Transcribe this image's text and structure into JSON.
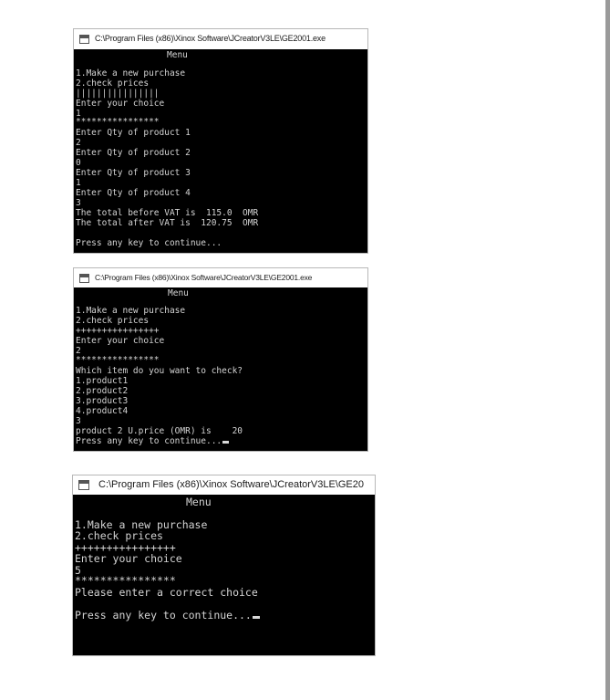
{
  "windows": [
    {
      "title": "C:\\Program Files (x86)\\Xinox Software\\JCreatorV3LE\\GE2001.exe",
      "menu_heading": "Menu",
      "lines": [
        "1.Make a new purchase",
        "2.check prices",
        "||||||||||||||||",
        "Enter your choice",
        "1",
        "****************",
        "Enter Qty of product 1",
        "2",
        "Enter Qty of product 2",
        "0",
        "Enter Qty of product 3",
        "1",
        "Enter Qty of product 4",
        "3",
        "The total before VAT is  115.0  OMR",
        "The total after VAT is  120.75  OMR",
        "",
        "Press any key to continue..."
      ]
    },
    {
      "title": "C:\\Program Files (x86)\\Xinox Software\\JCreatorV3LE\\GE2001.exe",
      "menu_heading": "Menu",
      "lines": [
        "1.Make a new purchase",
        "2.check prices",
        "++++++++++++++++",
        "Enter your choice",
        "2",
        "****************",
        "Which item do you want to check?",
        "1.product1",
        "2.product2",
        "3.product3",
        "4.product4",
        "3",
        "product 2 U.price (OMR) is    20",
        "Press any key to continue..."
      ]
    },
    {
      "title": "C:\\Program Files (x86)\\Xinox Software\\JCreatorV3LE\\GE20",
      "menu_heading": "Menu",
      "lines": [
        "1.Make a new purchase",
        "2.check prices",
        "++++++++++++++++",
        "Enter your choice",
        "5",
        "****************",
        "Please enter a correct choice",
        "",
        "Press any key to continue..."
      ]
    }
  ],
  "colors": {
    "console_background": "#000000",
    "console_text": "#d4d4d4",
    "titlebar_background": "#ffffff"
  },
  "icons": [
    "console-app-icon",
    "text-cursor"
  ]
}
